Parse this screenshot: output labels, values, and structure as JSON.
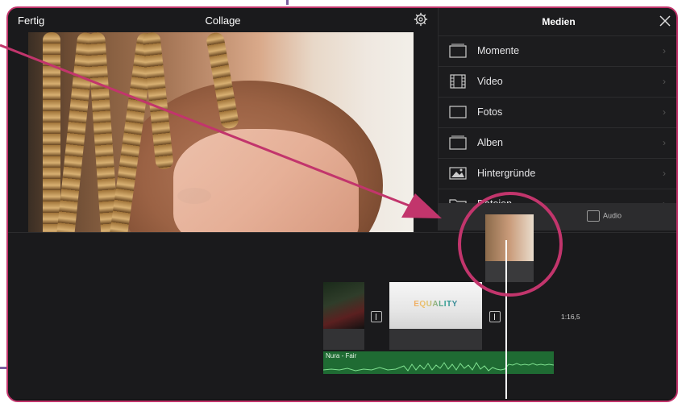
{
  "topbar": {
    "done_label": "Fertig",
    "project_title": "Collage"
  },
  "media": {
    "title": "Medien",
    "items": [
      {
        "label": "Momente",
        "icon": "stack-icon"
      },
      {
        "label": "Video",
        "icon": "film-icon"
      },
      {
        "label": "Fotos",
        "icon": "photo-frame-icon"
      },
      {
        "label": "Alben",
        "icon": "album-icon"
      },
      {
        "label": "Hintergründe",
        "icon": "landscape-icon"
      },
      {
        "label": "Dateien",
        "icon": "folder-icon"
      }
    ],
    "tabs": {
      "audio_label": "Audio"
    }
  },
  "timeline": {
    "timecode": "1:16,5",
    "audio_track_name": "Nura - Fair",
    "clip2_text": "EQUALITY"
  },
  "colors": {
    "accent": "#c2356c",
    "audio": "#1f6b33",
    "background": "#1a1a1c"
  }
}
